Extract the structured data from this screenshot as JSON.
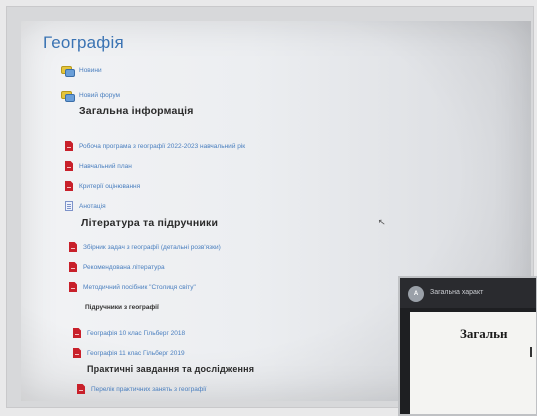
{
  "course": {
    "title": "Географія"
  },
  "items": {
    "news": "Новини",
    "new_forum": "Новий форум"
  },
  "sections": {
    "general": {
      "heading": "Загальна інформація",
      "items": [
        "Робоча програма з географії 2022-2023 навчальний рік",
        "Навчальний план",
        "Критерії оцінювання",
        "Анотація"
      ]
    },
    "literature": {
      "heading": "Література та підручники",
      "items": [
        "Збірник задач з географії (детальні розв'язки)",
        "Рекомендована література",
        "Методичний посібник \"Столиця світу\""
      ],
      "subheading": "Підручники з географії",
      "textbooks": [
        "Географія 10 клас Гільберг 2018",
        "Географія 11 клас Гільберг 2019"
      ]
    },
    "practical": {
      "heading": "Практичні завдання та дослідження",
      "items": [
        "Перелік практичних занять з географії"
      ]
    }
  },
  "video": {
    "logo": "A",
    "caption": "Загальна характ",
    "slide_title": "Загальн"
  },
  "icons": {
    "forum": "forum-icon",
    "pdf": "pdf-file-icon",
    "page": "page-icon",
    "cursor": "mouse-cursor-icon"
  }
}
